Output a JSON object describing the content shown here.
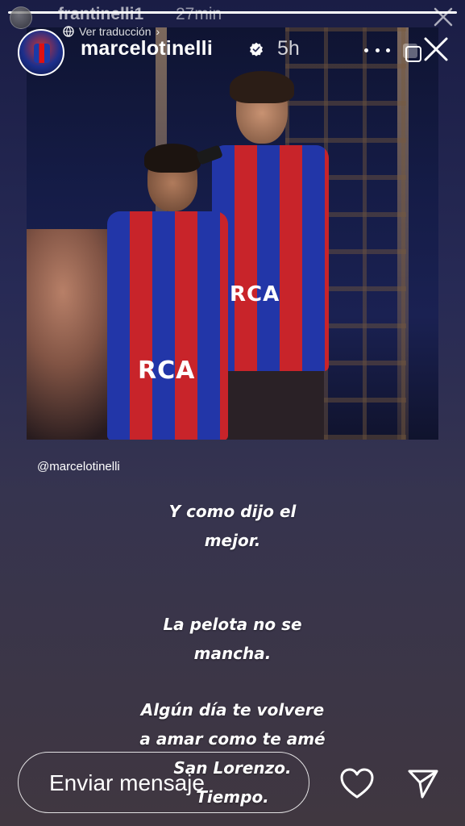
{
  "progress": {
    "segments": [
      1.0
    ]
  },
  "repost": {
    "username": "frantinelli1",
    "time": "27min"
  },
  "header": {
    "translate_label": "Ver traducción",
    "username": "marcelotinelli",
    "time": "5h"
  },
  "photo": {
    "jersey_text_left": "RCA",
    "jersey_text_right": "RCA"
  },
  "mention": "@marcelotinelli",
  "text": {
    "block1": [
      "Y como dijo el",
      "mejor."
    ],
    "block2": [
      "La pelota no se",
      "mancha."
    ],
    "block3": [
      "Algún día te volvere",
      "a amar como te amé",
      "San Lorenzo.",
      "Tiempo."
    ]
  },
  "footer": {
    "message_placeholder": "Enviar mensaje"
  }
}
